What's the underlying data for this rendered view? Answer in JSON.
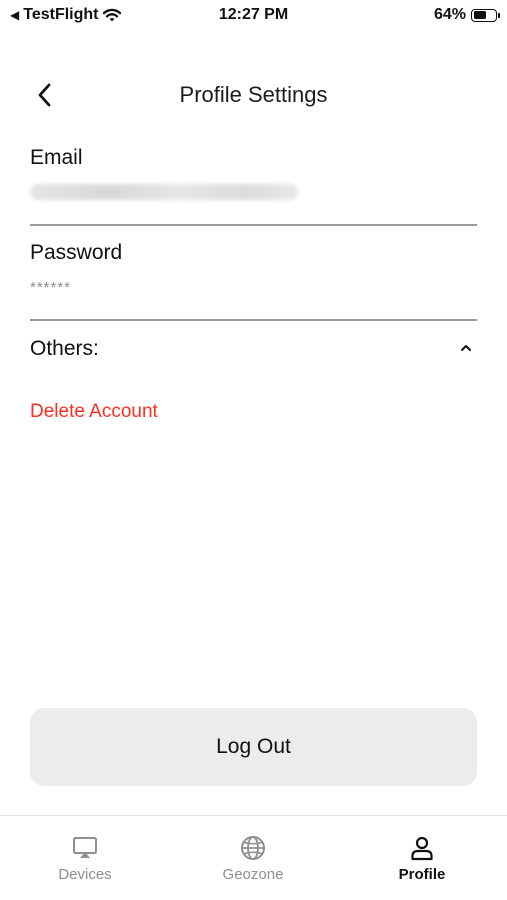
{
  "status_bar": {
    "back_app": "TestFlight",
    "time": "12:27 PM",
    "battery_percent": "64%",
    "battery_level": 0.64
  },
  "header": {
    "title": "Profile Settings"
  },
  "email": {
    "label": "Email"
  },
  "password": {
    "label": "Password",
    "value": "******"
  },
  "others": {
    "label": "Others:",
    "expanded": true
  },
  "delete_account": {
    "label": "Delete Account",
    "color": "#ff2d20"
  },
  "logout": {
    "label": "Log Out"
  },
  "tabs": [
    {
      "label": "Devices",
      "icon": "airplay-icon",
      "active": false
    },
    {
      "label": "Geozone",
      "icon": "globe-icon",
      "active": false
    },
    {
      "label": "Profile",
      "icon": "person-icon",
      "active": true
    }
  ]
}
